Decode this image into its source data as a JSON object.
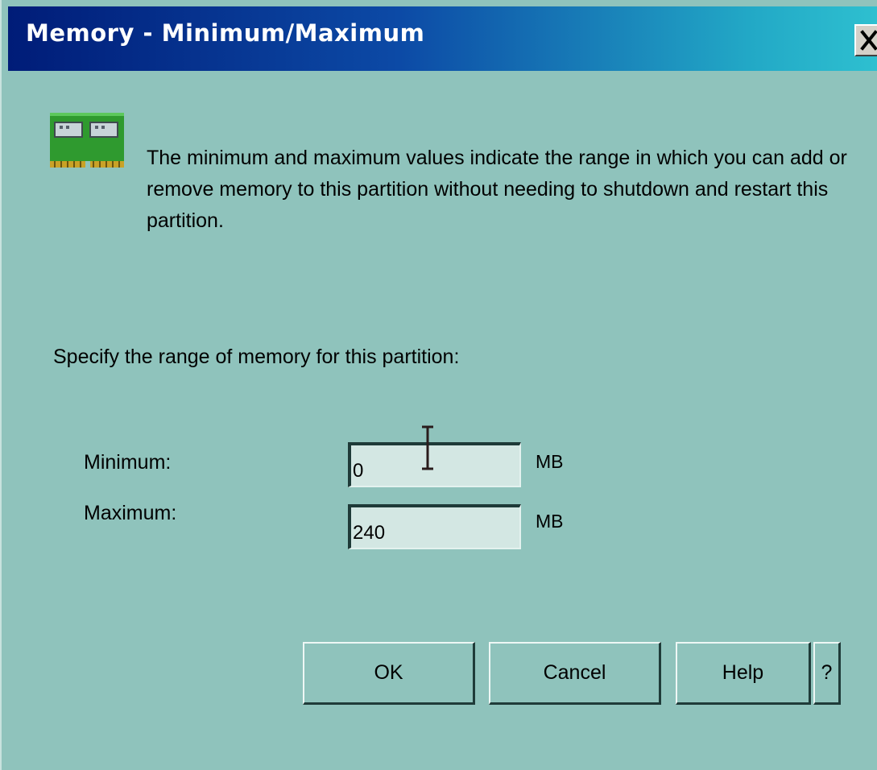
{
  "window": {
    "title": "Memory - Minimum/Maximum",
    "close_label": "X"
  },
  "description": "The minimum and maximum values indicate the range in which you can add or remove memory to this partition without needing to shutdown and restart this partition.",
  "range_prompt": "Specify the range of memory for this partition:",
  "fields": {
    "minimum": {
      "label": "Minimum:",
      "value": "0",
      "unit": "MB"
    },
    "maximum": {
      "label": "Maximum:",
      "value": "240",
      "unit": "MB"
    }
  },
  "buttons": {
    "ok": "OK",
    "cancel": "Cancel",
    "help": "Help",
    "context_help": "?"
  },
  "icons": {
    "memory": "memory-module-icon",
    "close": "close-icon",
    "cursor": "text-cursor-icon"
  },
  "colors": {
    "background": "#8fc3bc",
    "title_start": "#001c78",
    "title_end": "#2ec0d0",
    "field_bg": "#d3e7e3",
    "icon_green": "#2f9a2f"
  }
}
